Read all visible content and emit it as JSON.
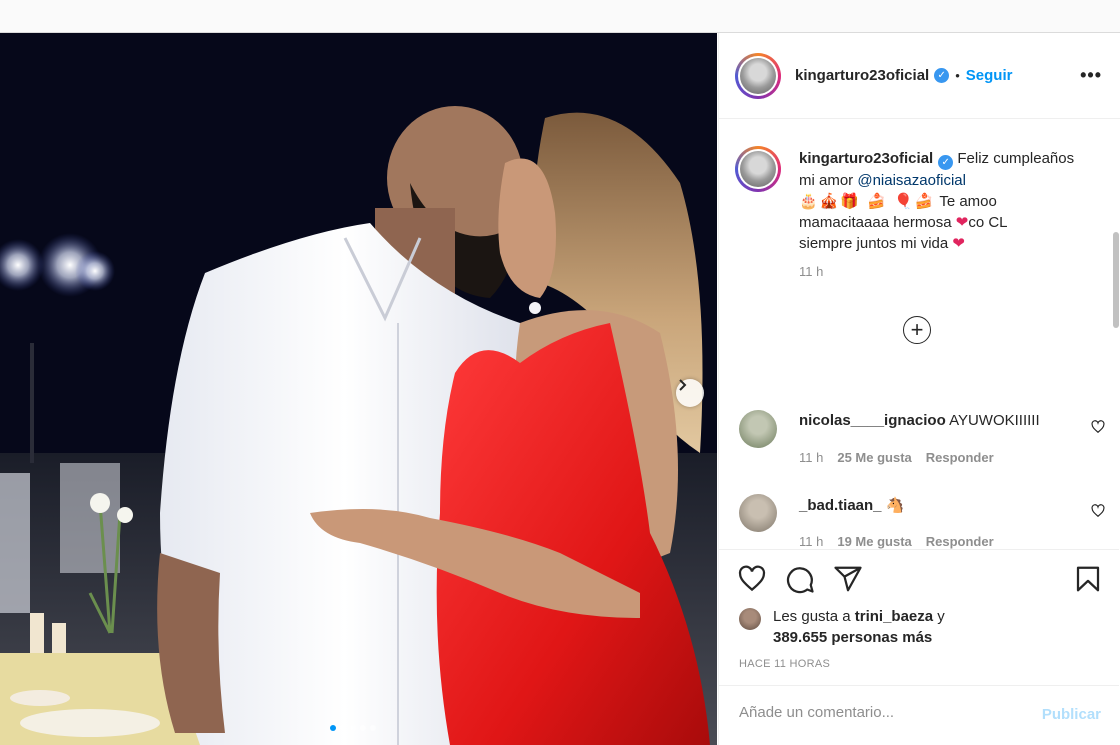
{
  "header": {
    "username": "kingarturo23oficial",
    "verified_mark": "✓",
    "separator": "•",
    "follow_label": "Seguir",
    "more_label": "•••"
  },
  "caption": {
    "username": "kingarturo23oficial",
    "text_before_mention": "Feliz cumpleaños mi amor",
    "mention": "@niaisazaoficial",
    "emojis": "🎂🎪🎁 🍰 🎈🍰",
    "text_line2": "Te amoo mamacitaaaa hermosa",
    "heart": "❤",
    "flag_text": "co CL",
    "text_line3": "siempre juntos mi vida",
    "time": "11 h"
  },
  "load_more_label": "+",
  "comments": [
    {
      "username": "nicolas____ignacioo",
      "text": "AYUWOKIIIIII",
      "time": "11 h",
      "likes": "25 Me gusta",
      "reply": "Responder",
      "avatar_color": "#6b7a5a"
    },
    {
      "username": "_bad.tiaan_",
      "text": "🐴",
      "time": "11 h",
      "likes": "19 Me gusta",
      "reply": "Responder",
      "avatar_color": "#7d7468"
    }
  ],
  "actions": {
    "icons": [
      "heart-icon",
      "comment-icon",
      "share-icon",
      "bookmark-icon"
    ]
  },
  "likes": {
    "prefix": "Les gusta a",
    "user": "trini_baeza",
    "suffix": "y",
    "count_text": "389.655 personas más"
  },
  "time_ago": "HACE 11 HORAS",
  "add_comment": {
    "placeholder": "Añade un comentario...",
    "publish_label": "Publicar"
  },
  "carousel": {
    "total": 5,
    "active": 1,
    "next_icon": "chevron-right-icon"
  },
  "colors": {
    "accent": "#0095f6",
    "publish_disabled": "#b2dffc",
    "heart": "#e0245e"
  }
}
